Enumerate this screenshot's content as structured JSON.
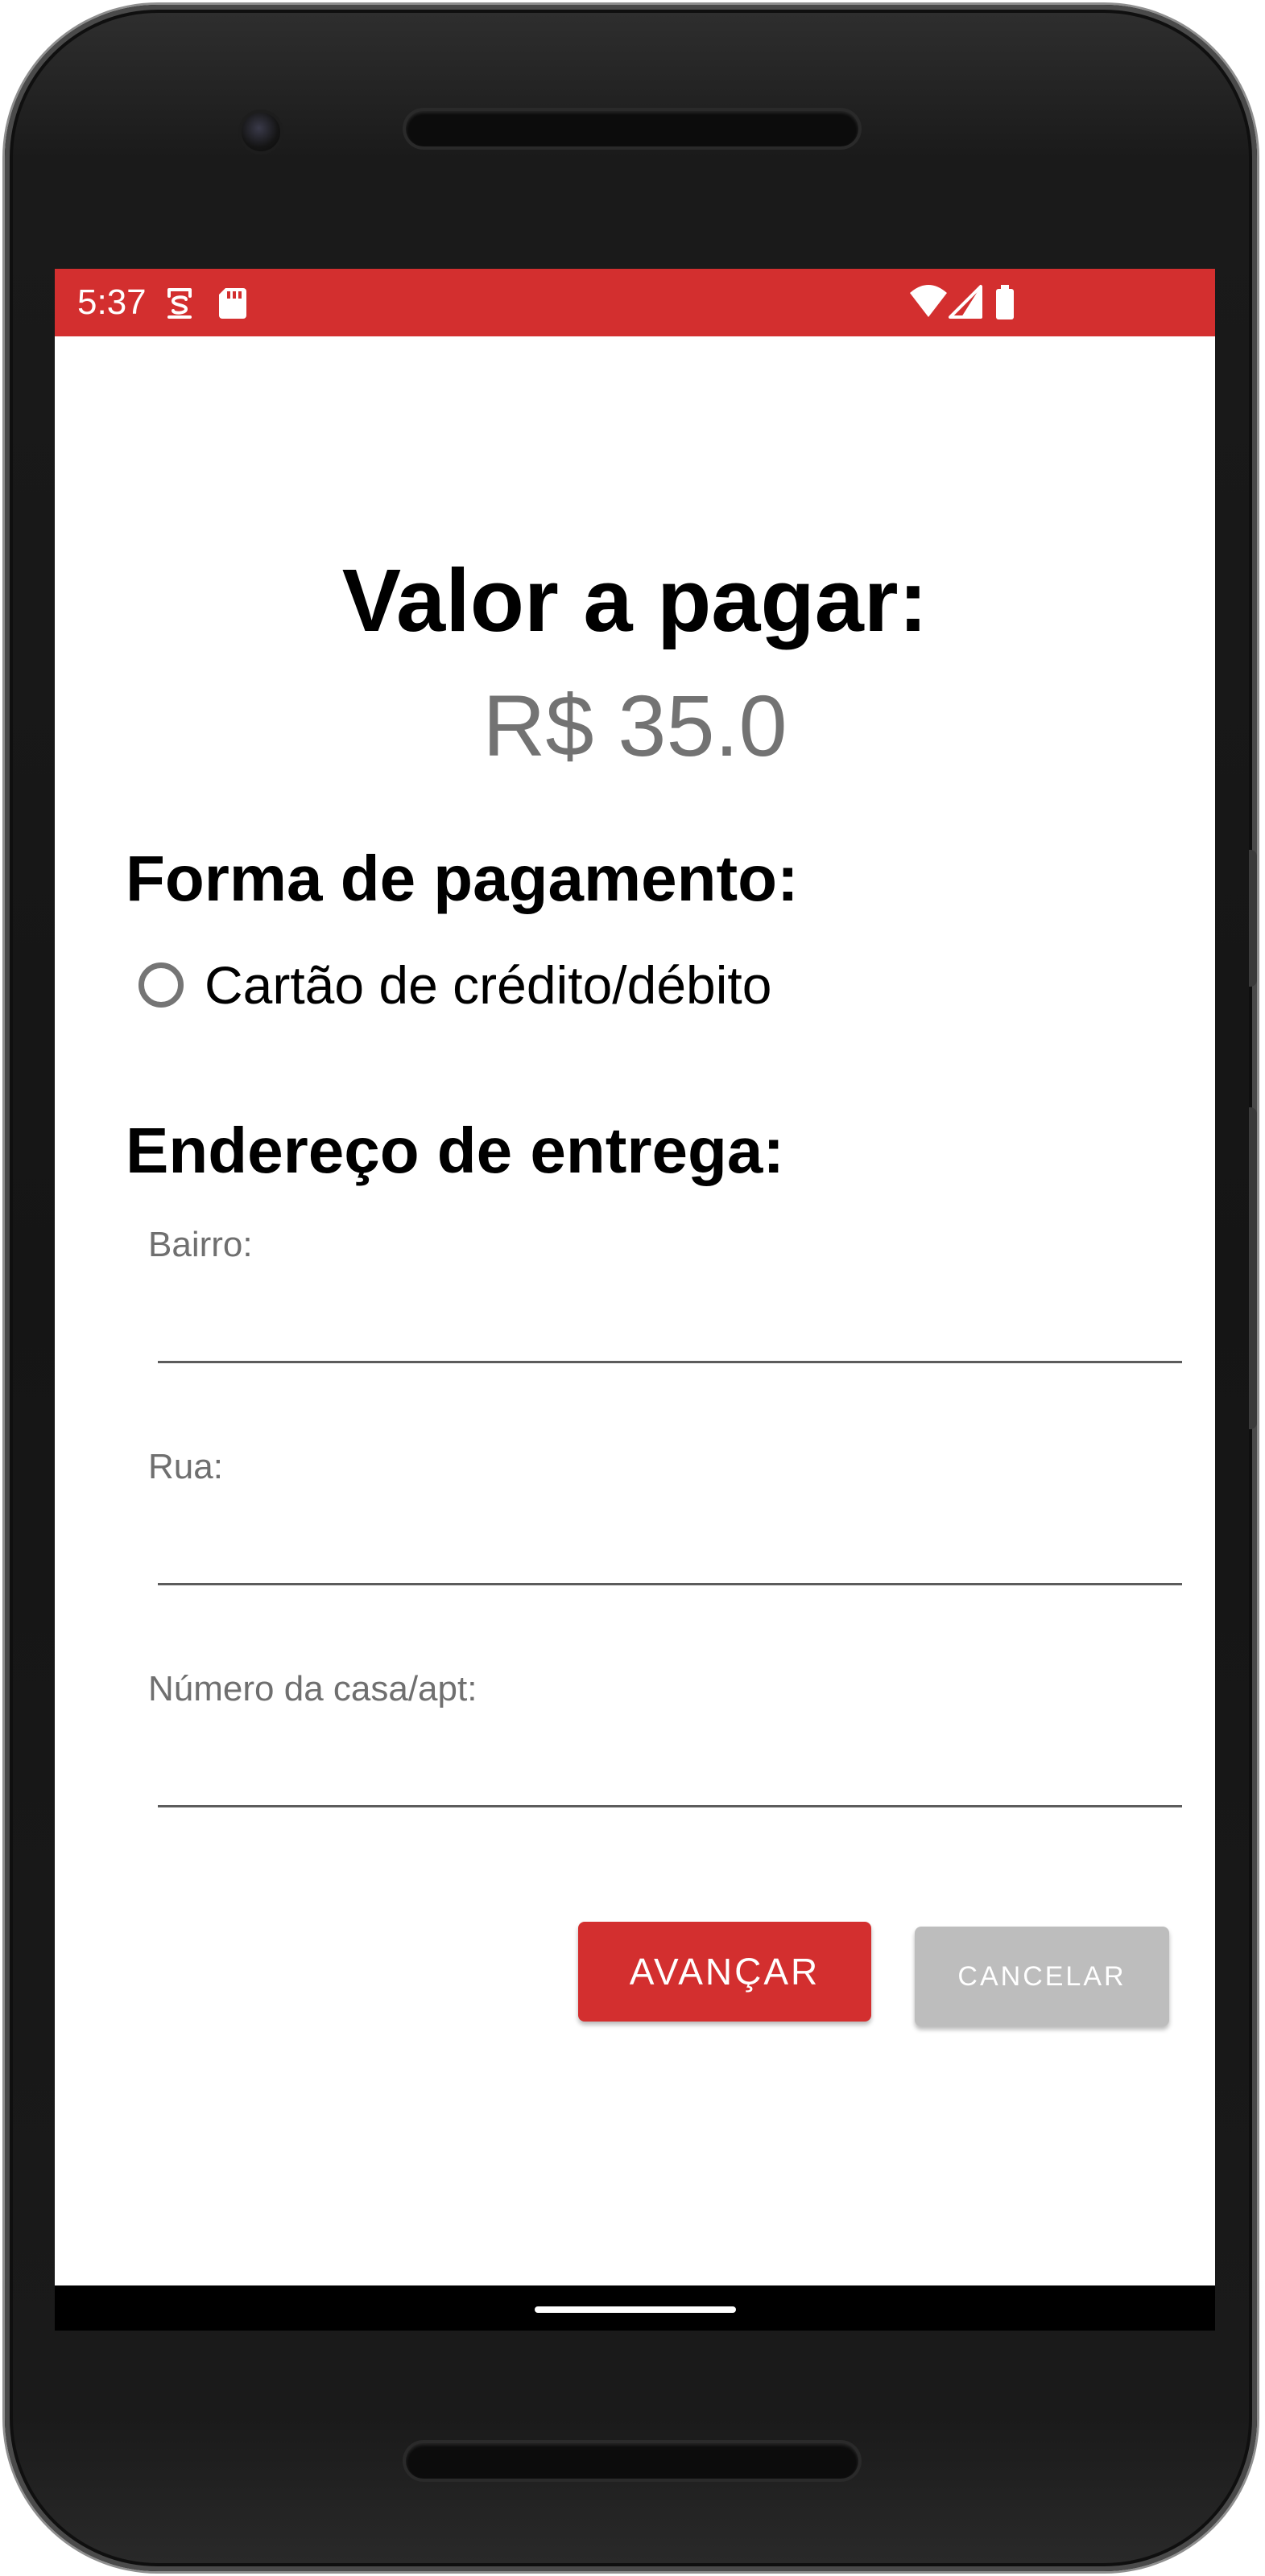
{
  "status_bar": {
    "time": "5:37",
    "background_color": "#d32f2f",
    "left_icons": [
      "app-notification-icon",
      "sd-card-icon"
    ],
    "right_icons": [
      "wifi-icon",
      "cell-signal-icon",
      "battery-icon"
    ]
  },
  "payment": {
    "title": "Valor a pagar:",
    "amount": "R$ 35.0",
    "method_heading": "Forma de pagamento:",
    "method_option": {
      "label": "Cartão de crédito/débito",
      "selected": false
    }
  },
  "address": {
    "heading": "Endereço de entrega:",
    "fields": [
      {
        "label": "Bairro:",
        "value": ""
      },
      {
        "label": "Rua:",
        "value": ""
      },
      {
        "label": "Número da casa/apt:",
        "value": ""
      }
    ]
  },
  "actions": {
    "next_label": "Avançar",
    "cancel_label": "Cancelar",
    "next_color": "#d32f2f",
    "cancel_color": "#bdbdbd"
  }
}
